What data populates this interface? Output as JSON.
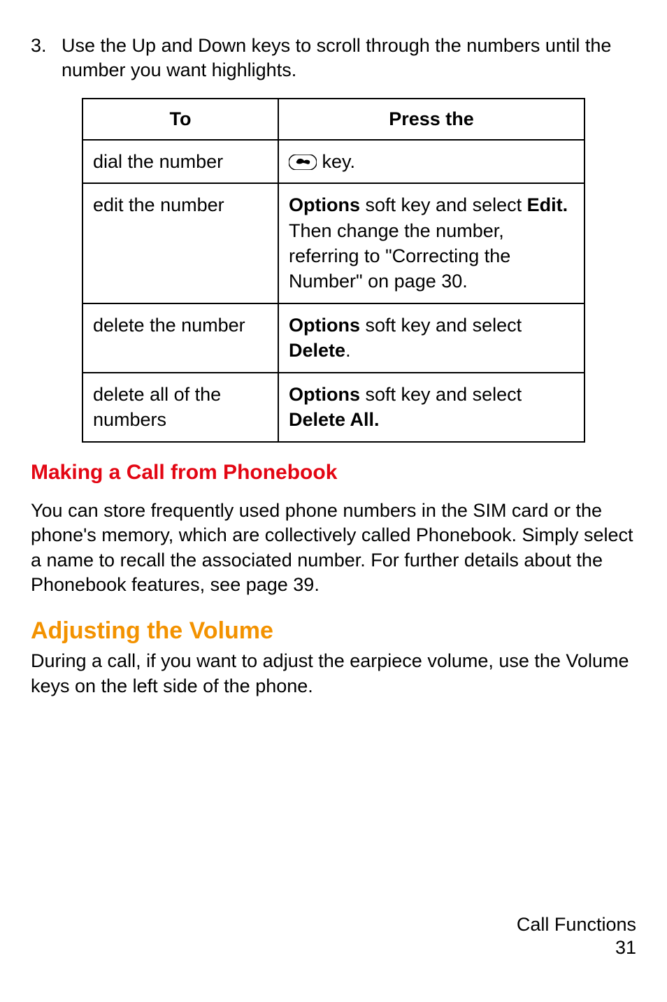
{
  "step": {
    "number": "3.",
    "text": "Use the Up and Down keys to scroll through the numbers until the number you want highlights."
  },
  "table": {
    "header": {
      "col1": "To",
      "col2": "Press the"
    },
    "rows": [
      {
        "to": "dial the number",
        "press_icon": "call-key-icon",
        "press_suffix": " key."
      },
      {
        "to": "edit the number",
        "press_parts": [
          {
            "bold": true,
            "text": "Options"
          },
          {
            "bold": false,
            "text": " soft key and select "
          },
          {
            "bold": true,
            "text": "Edit."
          },
          {
            "bold": false,
            "text": " Then change the number, referring to \"Correcting the Number\" on page 30."
          }
        ]
      },
      {
        "to": "delete the number",
        "press_parts": [
          {
            "bold": true,
            "text": "Options"
          },
          {
            "bold": false,
            "text": " soft key and select "
          },
          {
            "bold": true,
            "text": "Delete"
          },
          {
            "bold": false,
            "text": "."
          }
        ]
      },
      {
        "to": "delete all of the numbers",
        "press_parts": [
          {
            "bold": true,
            "text": "Options"
          },
          {
            "bold": false,
            "text": " soft key and select "
          },
          {
            "bold": true,
            "text": "Delete All."
          }
        ]
      }
    ]
  },
  "section1": {
    "heading": "Making a Call from Phonebook",
    "body": "You can store frequently used phone numbers in the SIM card or the phone's memory, which are collectively called Phonebook. Simply select a name to recall the associated number. For further details about the Phonebook features, see page 39."
  },
  "section2": {
    "heading": "Adjusting the Volume",
    "body": "During a call, if you want to adjust the earpiece volume, use the Volume keys on the left side of the phone."
  },
  "footer": {
    "section": "Call Functions",
    "page": "31"
  }
}
